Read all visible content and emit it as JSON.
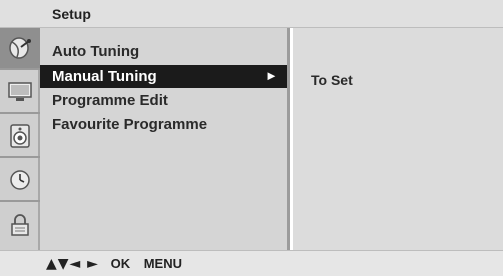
{
  "header": {
    "title": "Setup"
  },
  "icons": [
    {
      "name": "satellite-dish-icon",
      "active": true
    },
    {
      "name": "monitor-icon",
      "active": false
    },
    {
      "name": "speaker-icon",
      "active": false
    },
    {
      "name": "clock-icon",
      "active": false
    },
    {
      "name": "lock-icon",
      "active": false
    }
  ],
  "menu": {
    "items": [
      {
        "label": "Auto Tuning",
        "selected": false
      },
      {
        "label": "Manual Tuning",
        "selected": true,
        "arrow": "►"
      },
      {
        "label": "Programme Edit",
        "selected": false
      },
      {
        "label": "Favourite Programme",
        "selected": false
      }
    ]
  },
  "submenu": {
    "text": "To Set"
  },
  "footer": {
    "nav_keys": "▲▼◄ ►",
    "ok_label": "OK",
    "menu_label": "MENU"
  },
  "colors": {
    "header_bg": "#e0e0e0",
    "iconbar_bg": "#cfcfcf",
    "menu_bg": "#d5d5d5",
    "selected_bg": "#1b1b1b",
    "submenu_bg": "#dcdcdc"
  }
}
